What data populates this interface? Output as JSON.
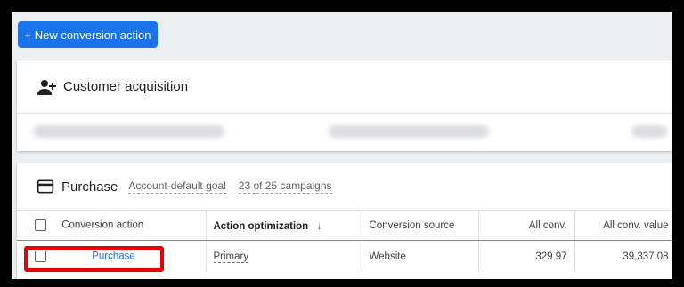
{
  "toolbar": {
    "new_button_label": "+ New conversion action"
  },
  "goal_card": {
    "title": "Customer acquisition"
  },
  "purchase_card": {
    "title": "Purchase",
    "goal_type": "Account-default goal",
    "campaigns": "23 of 25 campaigns"
  },
  "table": {
    "columns": {
      "action": "Conversion action",
      "optimization": "Action optimization",
      "source": "Conversion source",
      "all_conv": "All conv.",
      "all_conv_value": "All conv. value"
    },
    "sort_icon": "arrow-down-icon",
    "rows": [
      {
        "action": "Purchase",
        "optimization": "Primary",
        "source": "Website",
        "all_conv": "329.97",
        "all_conv_value": "39,337.08"
      }
    ]
  },
  "colors": {
    "accent": "#1a73e8",
    "highlight": "#e60000"
  }
}
